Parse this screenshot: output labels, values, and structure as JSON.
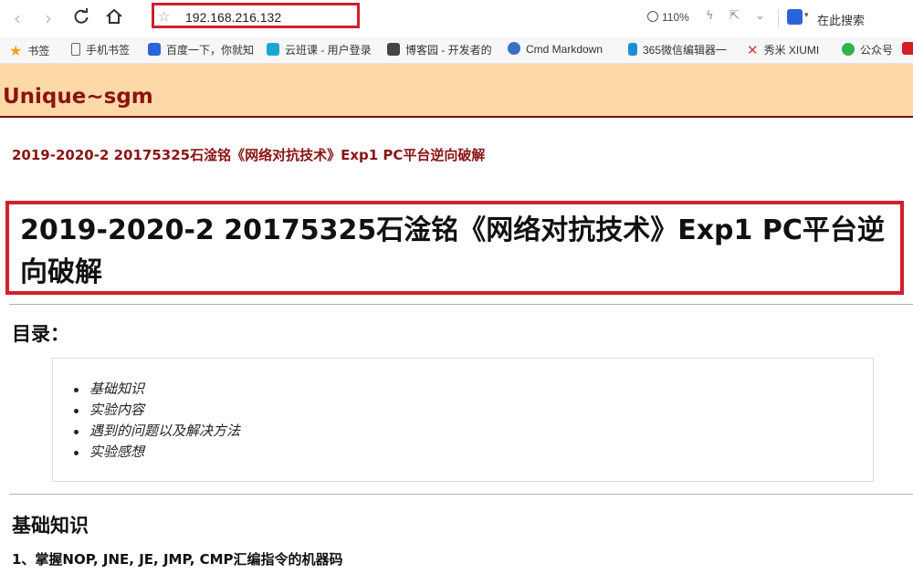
{
  "browser": {
    "url": "192.168.216.132",
    "zoom": "110%",
    "search_label": "在此搜索",
    "brand_color": "#d21f2a"
  },
  "bookmarks": [
    {
      "label": "书签",
      "icon": "star-icon",
      "color": "#f0a020"
    },
    {
      "label": "手机书签",
      "icon": "phone-icon",
      "color": "#666666"
    },
    {
      "label": "百度一下，你就知",
      "icon": "baidu-icon",
      "color": "#2b63d9"
    },
    {
      "label": "云班课 - 用户登录",
      "icon": "cloud-class-icon",
      "color": "#19a5d8"
    },
    {
      "label": "博客园 - 开发者的",
      "icon": "cnblogs-icon",
      "color": "#444444"
    },
    {
      "label": "Cmd Markdown",
      "icon": "cmd-markdown-icon",
      "color": "#3b6fc4"
    },
    {
      "label": "365微信编辑器一",
      "icon": "editor365-icon",
      "color": "#1b8fd6"
    },
    {
      "label": "秀米 XIUMI",
      "icon": "xiumi-icon",
      "color": "#d63b3b"
    },
    {
      "label": "公众号",
      "icon": "wechat-mp-icon",
      "color": "#2fb34a"
    }
  ],
  "site": {
    "title": "Unique~sgm",
    "header_bg": "#fdd9a8",
    "accent": "#8a1313"
  },
  "post": {
    "link_title": "2019-2020-2 20175325石淦铭《网络对抗技术》Exp1 PC平台逆向破解",
    "title": "2019-2020-2 20175325石淦铭《网络对抗技术》Exp1 PC平台逆向破解"
  },
  "toc": {
    "heading": "目录：",
    "items": [
      "基础知识",
      "实验内容",
      "遇到的问题以及解决方法",
      "实验感想"
    ]
  },
  "section": {
    "heading": "基础知识",
    "subheading": "1、掌握NOP, JNE, JE, JMP, CMP汇编指令的机器码"
  }
}
